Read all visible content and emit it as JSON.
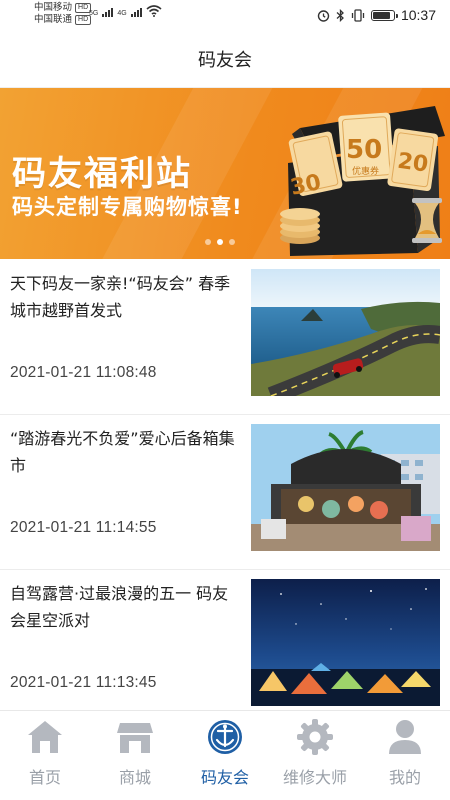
{
  "status_bar": {
    "carrier1": "中国移动",
    "carrier2": "中国联通",
    "hd": "HD",
    "net1": "5G",
    "net2": "4G",
    "time": "10:37"
  },
  "header": {
    "title": "码友会"
  },
  "banner": {
    "title": "码友福利站",
    "subtitle": "码头定制专属购物惊喜!",
    "ticket1": "30",
    "ticket2": "50",
    "ticket2_caption": "优惠券",
    "ticket3": "20",
    "slide_count": 3,
    "active_slide": 2
  },
  "feed": [
    {
      "title": "天下码友一家亲!“码友会” 春季城市越野首发式",
      "time": "2021-01-21 11:08:48",
      "image": "coastal road with car"
    },
    {
      "title": "“踏游春光不负爱”爱心后备箱集市",
      "time": "2021-01-21 11:14:55",
      "image": "car trunk market"
    },
    {
      "title": "自驾露营·过最浪漫的五一 码友会星空派对",
      "time": "2021-01-21 11:13:45",
      "image": "tents under starry sky"
    }
  ],
  "tabs": [
    {
      "label": "首页",
      "icon": "home-icon",
      "active": false
    },
    {
      "label": "商城",
      "icon": "store-icon",
      "active": false
    },
    {
      "label": "码友会",
      "icon": "club-logo-icon",
      "active": true
    },
    {
      "label": "维修大师",
      "icon": "gear-icon",
      "active": false
    },
    {
      "label": "我的",
      "icon": "user-icon",
      "active": false
    }
  ],
  "colors": {
    "accent": "#1f5fa5",
    "banner": "#f08a1d",
    "inactive": "#9aa0a8"
  }
}
